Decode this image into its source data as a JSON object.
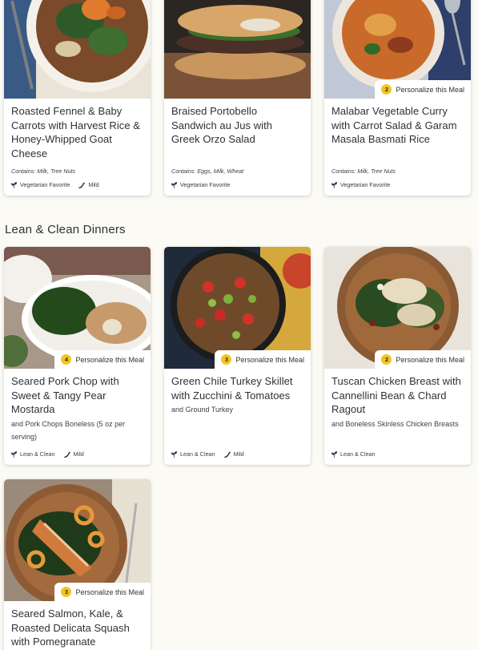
{
  "colors": {
    "page_bg": "#fbfaf4",
    "card_bg": "#ffffff",
    "badge": "#f2c426",
    "text": "#2f3136"
  },
  "top_row": [
    {
      "title": "Roasted Fennel & Baby Carrots with Harvest Rice & Honey-Whipped Goat Cheese",
      "contains": "Contains: Milk, Tree Nuts",
      "tags": [
        "Vegetarian Favorite",
        "Mild"
      ]
    },
    {
      "title": "Braised Portobello Sandwich au Jus with Greek Orzo Salad",
      "contains": "Contains: Eggs, Milk, Wheat",
      "tags": [
        "Vegetarian Favorite"
      ]
    },
    {
      "title": "Malabar Vegetable Curry with Carrot Salad & Garam Masala Basmati Rice",
      "contains": "Contains: Milk, Tree Nuts",
      "tags": [
        "Vegetarian Favorite"
      ],
      "personalize_label": "Personalize this Meal",
      "personalize_count": "2"
    }
  ],
  "section": {
    "heading": "Lean & Clean Dinners"
  },
  "lean_cards": [
    {
      "title": "Seared Pork Chop with Sweet & Tangy Pear Mostarda",
      "subtext": "and Pork Chops Boneless (5 oz per serving)",
      "tags": [
        "Lean & Clean",
        "Mild"
      ],
      "personalize_label": "Personalize this Meal",
      "personalize_count": "4"
    },
    {
      "title": "Green Chile Turkey Skillet with Zucchini & Tomatoes",
      "subtext": "and Ground Turkey",
      "tags": [
        "Lean & Clean",
        "Mild"
      ],
      "personalize_label": "Personalize this Meal",
      "personalize_count": "3"
    },
    {
      "title": "Tuscan Chicken Breast with Cannellini Bean & Chard Ragout",
      "subtext": "and Boneless Skinless Chicken Breasts",
      "tags": [
        "Lean & Clean"
      ],
      "personalize_label": "Personalize this Meal",
      "personalize_count": "2"
    },
    {
      "title": "Seared Salmon, Kale, & Roasted Delicata Squash with Pomegranate",
      "personalize_label": "Personalize this Meal",
      "personalize_count": "3"
    }
  ]
}
